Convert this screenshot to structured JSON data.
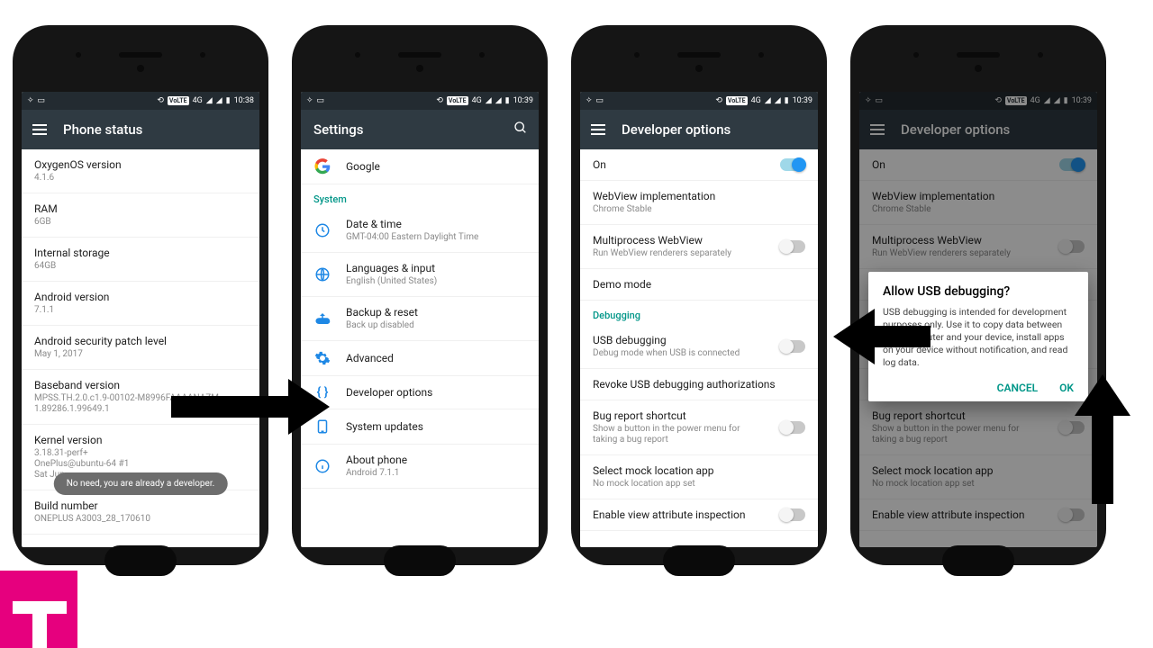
{
  "status": {
    "volte": "VoLTE",
    "net": "4G"
  },
  "times": [
    "10:38",
    "10:39",
    "10:39",
    "10:39"
  ],
  "phone1": {
    "title": "Phone status",
    "rows": [
      {
        "t": "OxygenOS version",
        "s": "4.1.6"
      },
      {
        "t": "RAM",
        "s": "6GB"
      },
      {
        "t": "Internal storage",
        "s": "64GB"
      },
      {
        "t": "Android version",
        "s": "7.1.1"
      },
      {
        "t": "Android security patch level",
        "s": "May 1, 2017"
      },
      {
        "t": "Baseband version",
        "s": "MPSS.TH.2.0.c1.9-00102-M8996FAAAANAZM-1.89286.1.99649.1"
      },
      {
        "t": "Kernel version",
        "s": "3.18.31-perf+\nOnePlus@ubuntu-64 #1\nSat Jun"
      },
      {
        "t": "Build number",
        "s": "ONEPLUS A3003_28_170610"
      }
    ],
    "toast": "No need, you are already a developer."
  },
  "phone2": {
    "title": "Settings",
    "google": "Google",
    "section": "System",
    "rows": [
      {
        "t": "Date & time",
        "s": "GMT-04:00 Eastern Daylight Time"
      },
      {
        "t": "Languages & input",
        "s": "English (United States)"
      },
      {
        "t": "Backup & reset",
        "s": "Back up disabled"
      },
      {
        "t": "Advanced",
        "s": ""
      },
      {
        "t": "Developer options",
        "s": ""
      },
      {
        "t": "System updates",
        "s": ""
      },
      {
        "t": "About phone",
        "s": "Android 7.1.1"
      }
    ]
  },
  "dev": {
    "title": "Developer options",
    "on": "On",
    "rows1": [
      {
        "t": "WebView implementation",
        "s": "Chrome Stable"
      },
      {
        "t": "Multiprocess WebView",
        "s": "Run WebView renderers separately",
        "sw": false
      },
      {
        "t": "Demo mode",
        "s": ""
      }
    ],
    "section": "Debugging",
    "rows2": [
      {
        "t": "USB debugging",
        "s": "Debug mode when USB is connected",
        "sw": false
      },
      {
        "t": "Revoke USB debugging authorizations",
        "s": ""
      },
      {
        "t": "Bug report shortcut",
        "s": "Show a button in the power menu for taking a bug report",
        "sw": false
      },
      {
        "t": "Select mock location app",
        "s": "No mock location app set"
      },
      {
        "t": "Enable view attribute inspection",
        "s": "",
        "sw": false
      }
    ]
  },
  "dialog": {
    "title": "Allow USB debugging?",
    "body": "USB debugging is intended for development purposes only. Use it to copy data between your computer and your device, install apps on your device without notification, and read log data.",
    "cancel": "CANCEL",
    "ok": "OK"
  }
}
